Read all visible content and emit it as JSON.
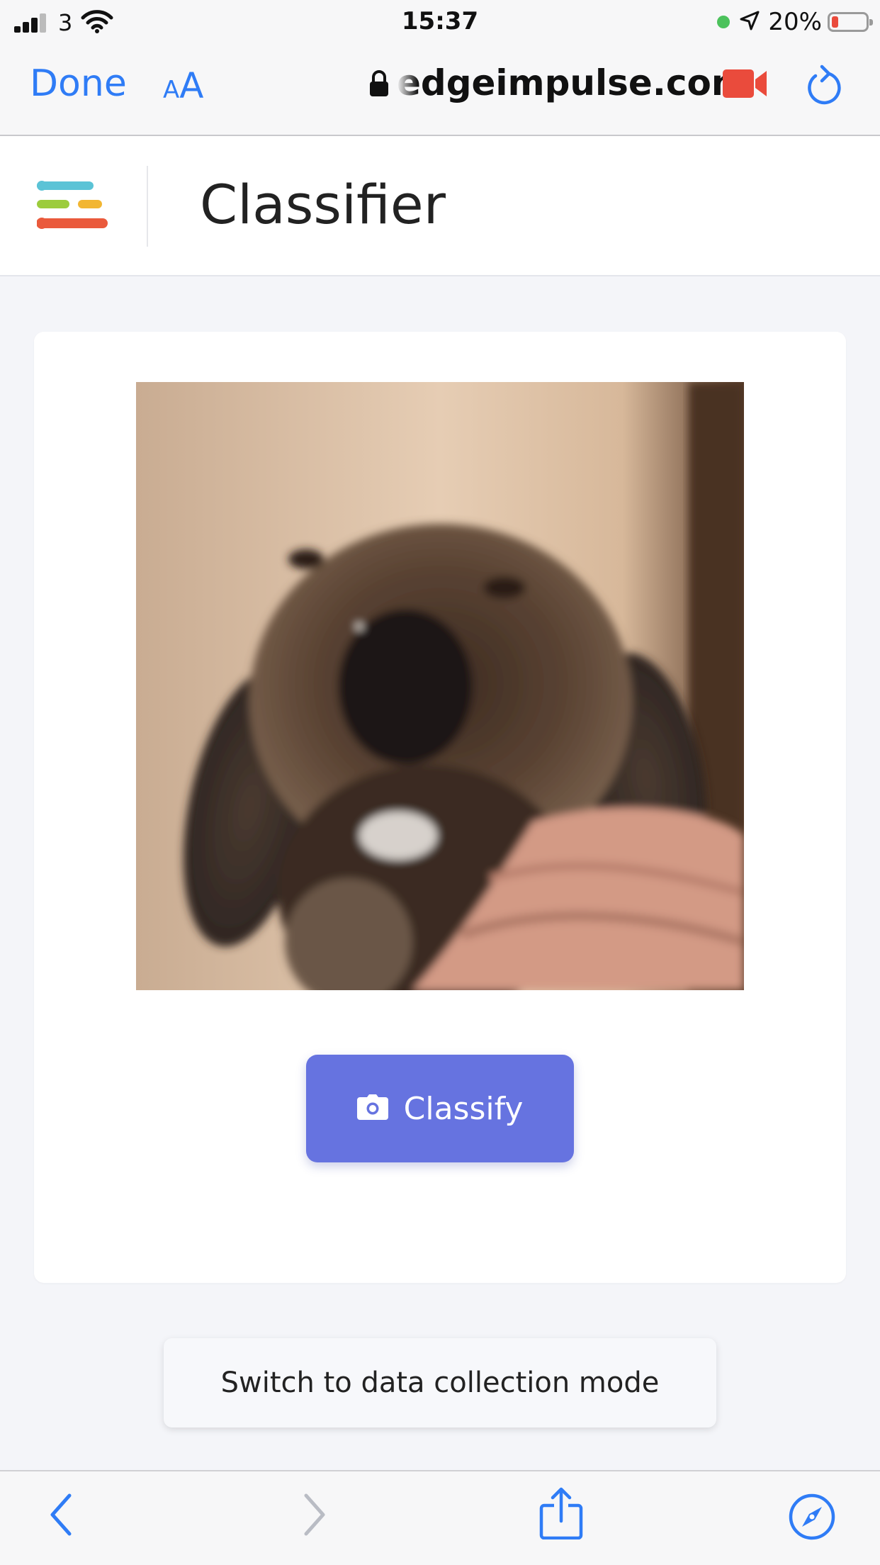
{
  "status_bar": {
    "carrier": "3",
    "time": "15:37",
    "battery_percent": "20%",
    "battery_level": 0.2,
    "icons": [
      "signal-icon",
      "wifi-icon",
      "location-arrow-icon",
      "battery-icon"
    ]
  },
  "browser": {
    "done_label": "Done",
    "text_size_small": "A",
    "text_size_large": "A",
    "url": "edgeimpulse.com",
    "icons": [
      "lock-icon",
      "video-camera-icon",
      "reload-icon"
    ]
  },
  "app": {
    "title": "Classifier",
    "logo_colors": [
      "#5bc3d6",
      "#9ccc3c",
      "#f2b632",
      "#ea5a3c"
    ]
  },
  "main": {
    "classify_label": "Classify",
    "switch_mode_label": "Switch to data collection mode",
    "accent_color": "#6673e0"
  },
  "toolbar": {
    "icons": [
      "back-icon",
      "forward-icon",
      "share-icon",
      "compass-icon"
    ]
  }
}
